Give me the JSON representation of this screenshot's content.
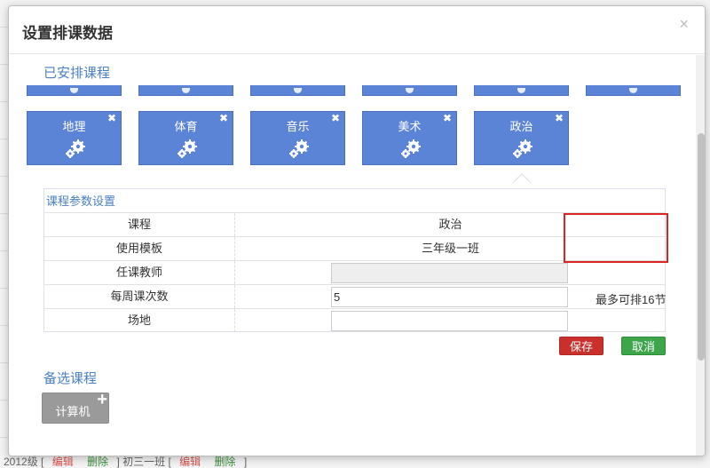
{
  "modal": {
    "title": "设置排课数据",
    "close": "×"
  },
  "arranged": {
    "title": "已安排课程",
    "courses": [
      {
        "label": "地理"
      },
      {
        "label": "体育"
      },
      {
        "label": "音乐"
      },
      {
        "label": "美术"
      },
      {
        "label": "政治"
      }
    ],
    "remove_glyph": "✖"
  },
  "params": {
    "title": "课程参数设置",
    "rows": {
      "course": {
        "label": "课程",
        "value": "政治"
      },
      "template": {
        "label": "使用模板",
        "value": "三年级一班"
      },
      "teacher": {
        "label": "任课教师",
        "value": ""
      },
      "weekly": {
        "label": "每周课次数",
        "value": "5",
        "hint": "最多可排16节"
      },
      "venue": {
        "label": "场地",
        "value": ""
      }
    }
  },
  "actions": {
    "save": "保存",
    "cancel": "取消"
  },
  "alternate": {
    "title": "备选课程",
    "courses": [
      {
        "label": "计算机"
      }
    ],
    "add_glyph": "+"
  },
  "background": {
    "footer_prefix": "2012级 [",
    "edit": "编辑",
    "delete": "删除",
    "footer_mid": "] 初三一班 [",
    "footer_end": "]"
  },
  "colors": {
    "tile_blue": "#5b84d6",
    "accent_blue": "#4a7fc1",
    "save_red": "#c9302c",
    "cancel_green": "#3da64a",
    "highlight_red": "#dd2222"
  }
}
